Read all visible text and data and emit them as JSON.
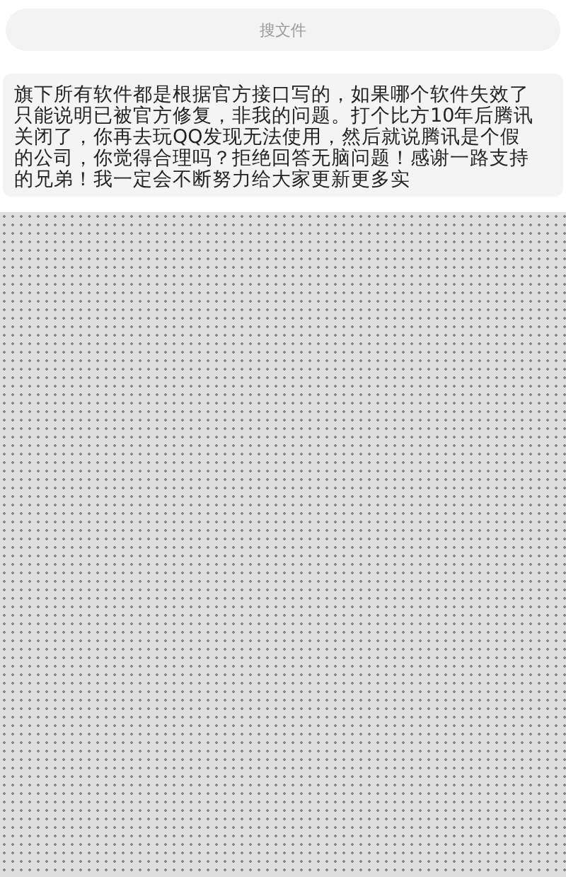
{
  "search": {
    "placeholder": "搜文件"
  },
  "message": {
    "lines": [
      "旗下所有软件都是根据官方接口写的，如果哪个软件失效了",
      "只能说明已被官方修复，非我的问题。打个比方10年后腾讯",
      "关闭了，你再去玩QQ发现无法使用，然后就说腾讯是个假",
      "的公司，你觉得合理吗？拒绝回答无脑问题！感谢一路支持",
      "的兄弟！我一定会不断努力给大家更新更多实"
    ]
  }
}
